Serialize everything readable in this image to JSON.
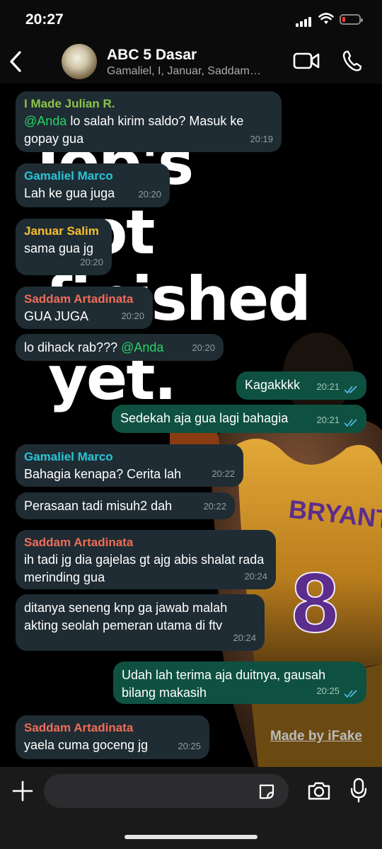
{
  "status": {
    "time": "20:27"
  },
  "header": {
    "title": "ABC 5 Dasar",
    "subtitle": "Gamaliel, I, Januar, Saddam…"
  },
  "wallpaper": {
    "line1": "Job's",
    "line2": "not",
    "line3": "finished",
    "line4": "yet.",
    "jersey_name": "BRYANT",
    "jersey_number": "8"
  },
  "watermark": "Made by iFake",
  "colors": {
    "julian": "#8bc34a",
    "gamaliel": "#26c6da",
    "januar": "#fbc02d",
    "saddam": "#ef6c58",
    "tick": "#53bdeb"
  },
  "messages": [
    {
      "sender": "I Made Julian R.",
      "mention": "@Anda",
      "text": " lo salah kirim saldo? Masuk ke gopay gua",
      "time": "20:19"
    },
    {
      "sender": "Gamaliel Marco",
      "text": "Lah ke gua juga",
      "time": "20:20"
    },
    {
      "sender": "Januar Salim",
      "text": "sama gua jg",
      "time": "20:20"
    },
    {
      "sender": "Saddam Artadinata",
      "text": "GUA JUGA",
      "time": "20:20"
    },
    {
      "text": "lo dihack rab??? ",
      "mention": "@Anda",
      "time": "20:20"
    },
    {
      "text": "Kagakkkk",
      "time": "20:21"
    },
    {
      "text": "Sedekah aja gua lagi bahagia",
      "time": "20:21"
    },
    {
      "sender": "Gamaliel Marco",
      "text": "Bahagia kenapa? Cerita lah",
      "time": "20:22"
    },
    {
      "text": "Perasaan tadi misuh2 dah",
      "time": "20:22"
    },
    {
      "sender": "Saddam Artadinata",
      "text": "ih tadi jg dia gajelas gt ajg abis shalat rada merinding gua",
      "time": "20:24"
    },
    {
      "text": "ditanya seneng knp ga jawab malah akting seolah pemeran utama di ftv",
      "time": "20:24"
    },
    {
      "text": "Udah lah terima aja duitnya, gausah bilang makasih",
      "time": "20:25"
    },
    {
      "sender": "Saddam Artadinata",
      "text": "yaela cuma goceng jg",
      "time": "20:25"
    }
  ]
}
